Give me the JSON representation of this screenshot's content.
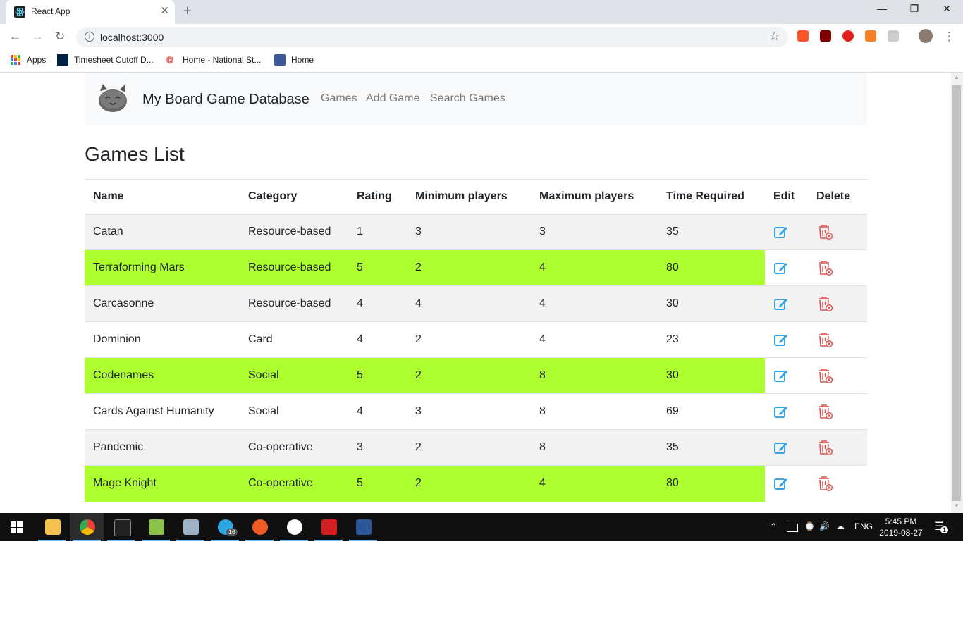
{
  "browser": {
    "tab_title": "React App",
    "tab_close": "✕",
    "new_tab": "+",
    "url": "localhost:3000",
    "bookmarks": [
      "Apps",
      "Timesheet Cutoff D...",
      "Home - National St...",
      "Home"
    ]
  },
  "window_controls": {
    "minimize": "—",
    "maximize": "❐",
    "close": "✕"
  },
  "nav": {
    "brand": "My Board Game Database",
    "links": [
      "Games",
      "Add Game",
      "Search Games"
    ]
  },
  "page": {
    "title": "Games List",
    "columns": [
      "Name",
      "Category",
      "Rating",
      "Minimum players",
      "Maximum players",
      "Time Required",
      "Edit",
      "Delete"
    ],
    "rows": [
      {
        "name": "Catan",
        "category": "Resource-based",
        "rating": "1",
        "min": "3",
        "max": "3",
        "time": "35",
        "highlight": false
      },
      {
        "name": "Terraforming Mars",
        "category": "Resource-based",
        "rating": "5",
        "min": "2",
        "max": "4",
        "time": "80",
        "highlight": true
      },
      {
        "name": "Carcasonne",
        "category": "Resource-based",
        "rating": "4",
        "min": "4",
        "max": "4",
        "time": "30",
        "highlight": false
      },
      {
        "name": "Dominion",
        "category": "Card",
        "rating": "4",
        "min": "2",
        "max": "4",
        "time": "23",
        "highlight": false
      },
      {
        "name": "Codenames",
        "category": "Social",
        "rating": "5",
        "min": "2",
        "max": "8",
        "time": "30",
        "highlight": true
      },
      {
        "name": "Cards Against Humanity",
        "category": "Social",
        "rating": "4",
        "min": "3",
        "max": "8",
        "time": "69",
        "highlight": false
      },
      {
        "name": "Pandemic",
        "category": "Co-operative",
        "rating": "3",
        "min": "2",
        "max": "8",
        "time": "35",
        "highlight": false
      },
      {
        "name": "Mage Knight",
        "category": "Co-operative",
        "rating": "5",
        "min": "2",
        "max": "4",
        "time": "80",
        "highlight": true
      }
    ],
    "highlight_color": "#adff2f",
    "edit_icon_color": "#3aa6e8",
    "delete_icon_color": "#d9534f"
  },
  "taskbar": {
    "lang": "ENG",
    "time": "5:45 PM",
    "date": "2019-08-27",
    "telegram_badge": "16",
    "notification_count": "1"
  }
}
